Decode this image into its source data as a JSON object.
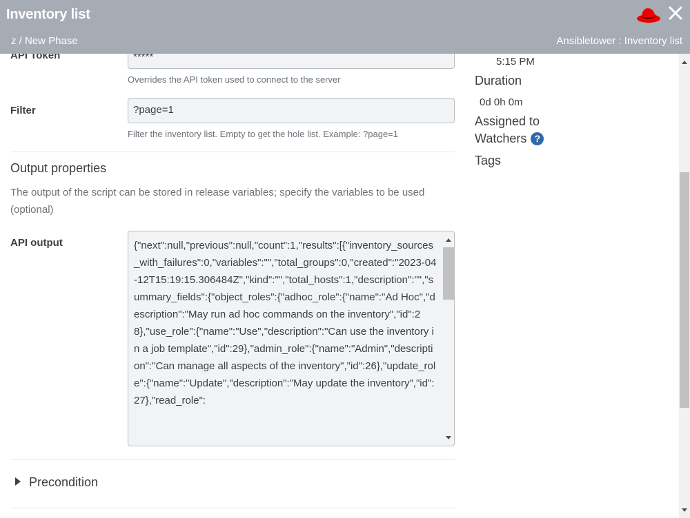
{
  "header": {
    "title": "Inventory list",
    "breadcrumb": "z / New Phase",
    "breadcrumb_right": "Ansibletower : Inventory list",
    "logo_icon": "redhat-hat-icon",
    "close_icon": "close-icon"
  },
  "form": {
    "api_token": {
      "label": "API Token",
      "value": "*****",
      "help": "Overrides the API token used to connect to the server"
    },
    "filter": {
      "label": "Filter",
      "value": "?page=1",
      "help": "Filter the inventory list. Empty to get the hole list. Example: ?page=1"
    },
    "output_properties": {
      "title": "Output properties",
      "description": "The output of the script can be stored in release variables; specify the variables to be used (optional)"
    },
    "api_output": {
      "label": "API output",
      "value": "{\"next\":null,\"previous\":null,\"count\":1,\"results\":[{\"inventory_sources_with_failures\":0,\"variables\":\"\",\"total_groups\":0,\"created\":\"2023-04-12T15:19:15.306484Z\",\"kind\":\"\",\"total_hosts\":1,\"description\":\"\",\"summary_fields\":{\"object_roles\":{\"adhoc_role\":{\"name\":\"Ad Hoc\",\"description\":\"May run ad hoc commands on the inventory\",\"id\":28},\"use_role\":{\"name\":\"Use\",\"description\":\"Can use the inventory in a job template\",\"id\":29},\"admin_role\":{\"name\":\"Admin\",\"description\":\"Can manage all aspects of the inventory\",\"id\":26},\"update_role\":{\"name\":\"Update\",\"description\":\"May update the inventory\",\"id\":27},\"read_role\":"
    },
    "precondition": {
      "label": "Precondition"
    }
  },
  "details": {
    "time": "5:15 PM",
    "duration_label": "Duration",
    "duration_value": "0d 0h 0m",
    "assigned_to_label": "Assigned to",
    "watchers_label": "Watchers",
    "watchers_help": "?",
    "tags_label": "Tags"
  },
  "colors": {
    "header_bg": "#a6acb3",
    "field_bg": "#f2f3f4",
    "help_icon": "#2f6aa8",
    "logo_red": "#ee0000"
  }
}
